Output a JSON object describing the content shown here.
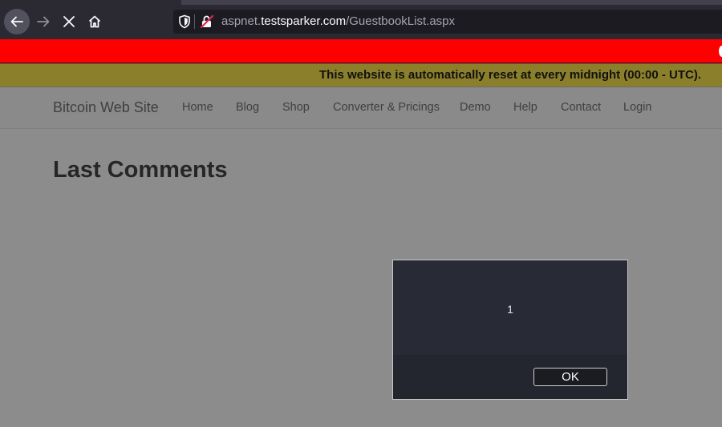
{
  "browser": {
    "url_scheme_host_prefix": "aspnet.",
    "url_domain": "testsparker.com",
    "url_path": "/GuestbookList.aspx",
    "icons": [
      "back-arrow-icon",
      "forward-arrow-icon",
      "stop-icon",
      "home-icon",
      "shield-icon",
      "insecure-lock-icon"
    ]
  },
  "notice": {
    "text": "This website is automatically reset at every midnight (00:00 - UTC)."
  },
  "site": {
    "brand": "Bitcoin Web Site",
    "nav": [
      {
        "label": "Home"
      },
      {
        "label": "Blog"
      },
      {
        "label": "Shop"
      },
      {
        "label": "Converter & Pricings"
      },
      {
        "label": "Demo"
      },
      {
        "label": "Help"
      },
      {
        "label": "Contact"
      },
      {
        "label": "Login"
      }
    ],
    "page_title": "Last Comments"
  },
  "dialog": {
    "message": "1",
    "ok_label": "OK"
  },
  "colors": {
    "toolbar": "#2b2a33",
    "redbar": "#fe0000",
    "notice": "#8b7f2b",
    "overlay_page": "#8c8c8c",
    "dialog": "#282a36"
  }
}
